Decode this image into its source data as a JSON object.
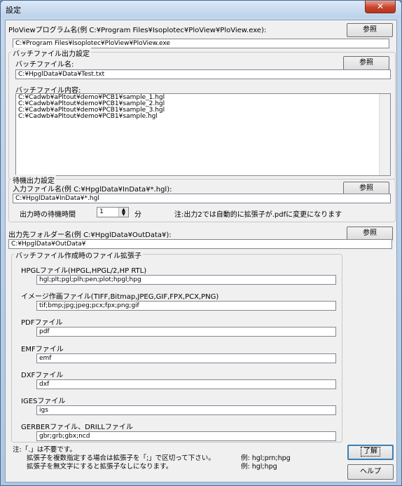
{
  "window": {
    "title": "設定",
    "close_glyph": "✕"
  },
  "ploview": {
    "label": "PloViewプログラム名(例 C:¥Program Files¥Isoplotec¥PloView¥PloView.exe):",
    "value": "C:¥Program Files¥Isoplotec¥PloView¥PloView.exe",
    "browse": "参照"
  },
  "batch_output": {
    "group_title": "バッチファイル出力設定",
    "file_label": "バッチファイル名:",
    "file_value": "C:¥HpglData¥Data¥Test.txt",
    "browse": "参照",
    "content_label": "バッチファイル内容:",
    "content_lines": [
      "C:¥Cadwb¥aPltout¥demo¥PCB1¥sample_1.hgl",
      "C:¥Cadwb¥aPltout¥demo¥PCB1¥sample_2.hgl",
      "C:¥Cadwb¥aPltout¥demo¥PCB1¥sample_3.hgl",
      "C:¥Cadwb¥aPltout¥demo¥PCB1¥sample.hgl"
    ]
  },
  "standby": {
    "group_title": "待機出力設定",
    "input_label": "入力ファイル名(例 C:¥HpglData¥InData¥*.hgl):",
    "input_value": "C:¥HpglData¥InData¥*.hgl",
    "browse": "参照",
    "wait_label": "出力時の待機時間",
    "wait_value": "1",
    "wait_unit": "分",
    "note": "注:出力2では自動的に拡張子が.pdfに変更になります"
  },
  "output_folder": {
    "label": "出力先フォルダー名(例 C:¥HpglData¥OutData¥):",
    "value": "C:¥HpglData¥OutData¥",
    "browse": "参照"
  },
  "extensions": {
    "group_title": "バッチファイル作成時のファイル拡張子",
    "items": [
      {
        "label": "HPGLファイル(HPGL,HPGL/2,HP RTL)",
        "value": "hgl;plt;pgl;plh;pen;plot;hpgl;hpg"
      },
      {
        "label": "イメージ作画ファイル(TIFF,Bitmap,JPEG,GIF,FPX,PCX,PNG)",
        "value": "tif;bmp;jpg;jpeg;pcx;fpx;png;gif"
      },
      {
        "label": "PDFファイル",
        "value": "pdf"
      },
      {
        "label": "EMFファイル",
        "value": "emf"
      },
      {
        "label": "DXFファイル",
        "value": "dxf"
      },
      {
        "label": "IGESファイル",
        "value": "igs"
      },
      {
        "label": "GERBERファイル、DRILLファイル",
        "value": "gbr;grb;gbx;ncd"
      }
    ]
  },
  "notes": {
    "line1": "注:「.」は不要です。",
    "line2": "拡張子を複数指定する場合は拡張子を「;」で区切って下さい。",
    "line2_example": "例: hgl;prn;hpg",
    "line3": "拡張子を無文字にすると拡張子なしになります。",
    "line3_example": "例: hgl;hpg"
  },
  "buttons": {
    "ok": "了解",
    "help": "ヘルプ"
  }
}
